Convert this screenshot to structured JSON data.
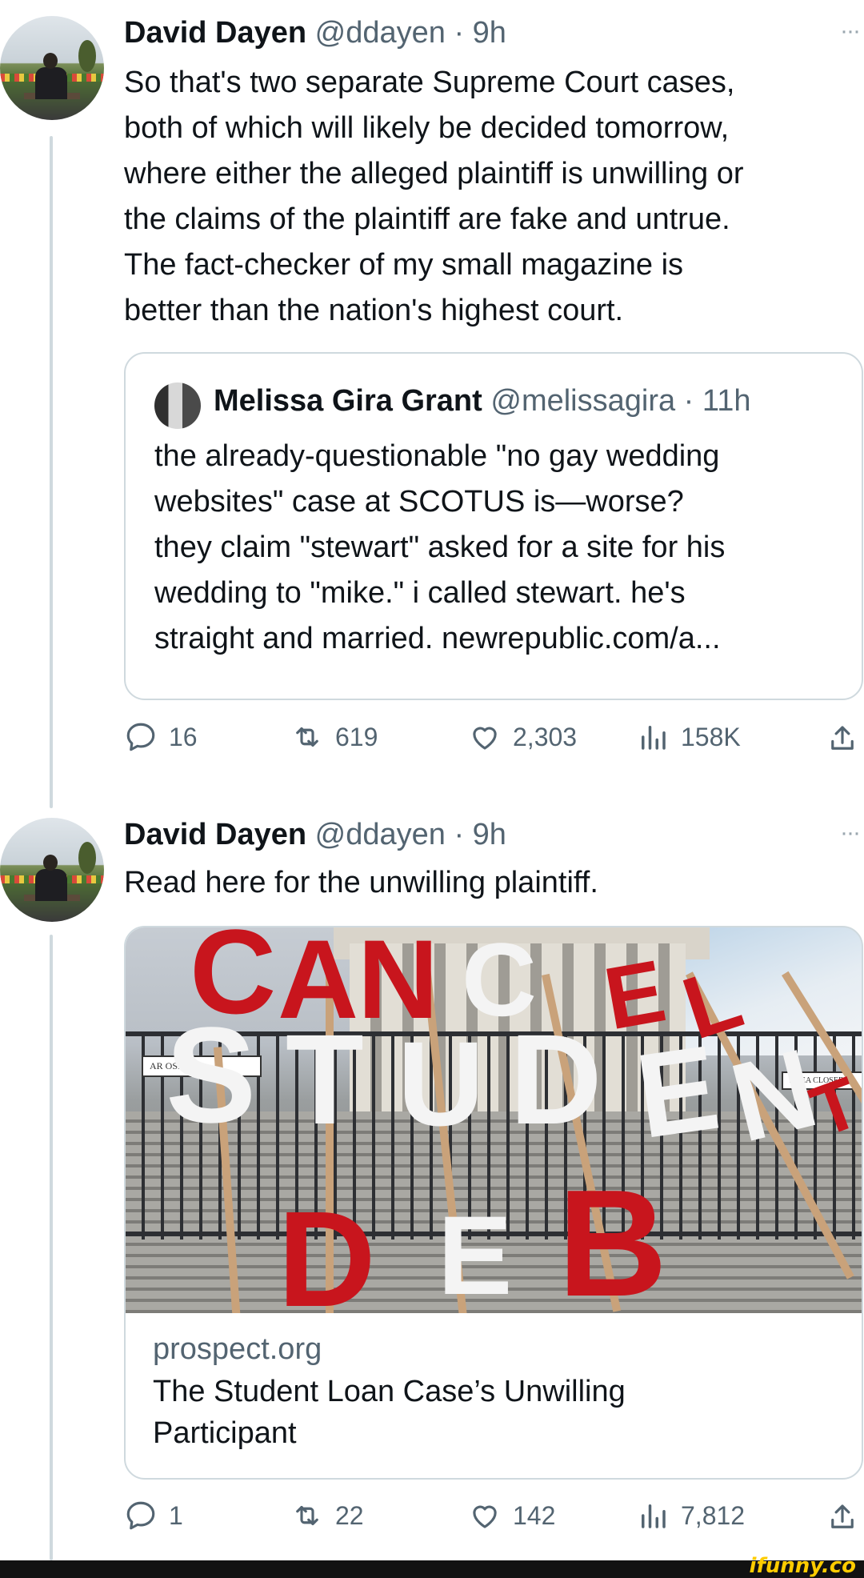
{
  "tweets": [
    {
      "author_name": "David Dayen",
      "handle_time": "@ddayen · 9h",
      "more": "···",
      "lines": [
        "So that's two separate Supreme Court cases,",
        "both of which will likely be decided tomorrow,",
        "where either the alleged plaintiff is unwilling or",
        "the claims of the plaintiff are fake and untrue.",
        "The fact-checker of my small magazine is",
        "better than the nation's highest court."
      ],
      "quote": {
        "author_name": "Melissa Gira Grant",
        "handle_time": "@melissagira · 11h",
        "lines": [
          "the already-questionable \"no gay wedding",
          "websites\" case at SCOTUS is—worse?",
          "they claim \"stewart\" asked for a site for his",
          "wedding to \"mike.\" i called stewart. he's",
          "straight and married. newrepublic.com/a..."
        ]
      },
      "actions": {
        "replies": "16",
        "retweets": "619",
        "likes": "2,303",
        "views": "158K"
      }
    },
    {
      "author_name": "David Dayen",
      "handle_time": "@ddayen · 9h",
      "more": "···",
      "lines": [
        "Read here for the unwilling plaintiff."
      ],
      "link_card": {
        "domain": "prospect.org",
        "title_lines": [
          "The Student Loan Case’s Unwilling",
          "Participant"
        ],
        "image_letters": [
          "C",
          "A",
          "N",
          "C",
          "E",
          "L",
          "S",
          "T",
          "U",
          "D",
          "E",
          "N",
          "T",
          "D",
          "E",
          "B"
        ],
        "image_signs": [
          "AR    OSED",
          "AREA CLOSED"
        ]
      },
      "actions": {
        "replies": "1",
        "retweets": "22",
        "likes": "142",
        "views": "7,812"
      }
    }
  ],
  "watermark": "ifunny.co",
  "colors": {
    "text": "#0f1419",
    "secondary": "#536471",
    "border": "#cfd9de",
    "letter_red": "#c8151d",
    "letter_white": "#f4f4f4"
  },
  "icons": [
    "reply-icon",
    "retweet-icon",
    "like-icon",
    "views-icon",
    "share-icon",
    "more-icon"
  ]
}
